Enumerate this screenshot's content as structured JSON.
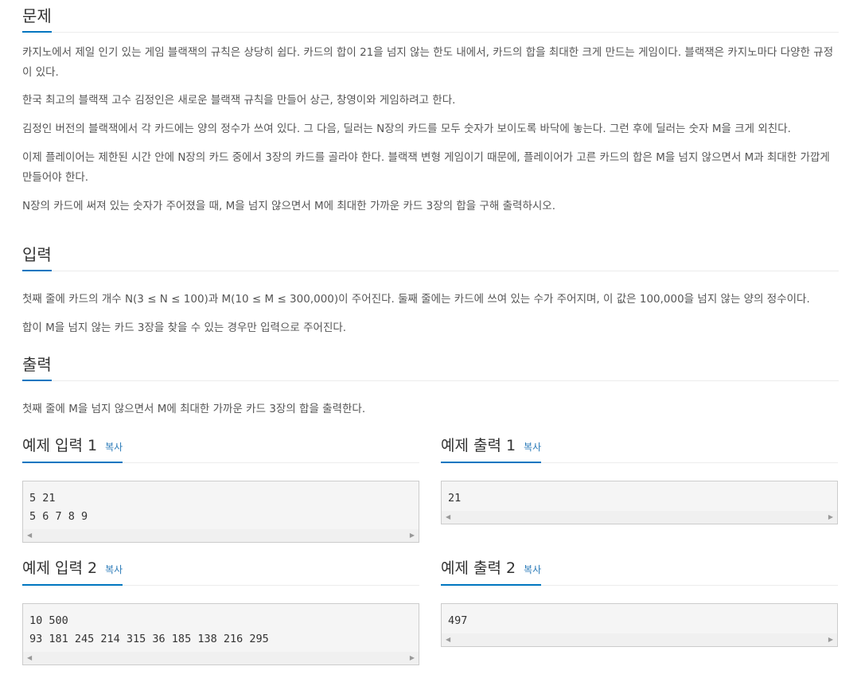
{
  "sections": {
    "problem": {
      "title": "문제",
      "paragraphs": [
        "카지노에서 제일 인기 있는 게임 블랙잭의 규칙은 상당히 쉽다. 카드의 합이 21을 넘지 않는 한도 내에서, 카드의 합을 최대한 크게 만드는 게임이다. 블랙잭은 카지노마다 다양한 규정이 있다.",
        "한국 최고의 블랙잭 고수 김정인은 새로운 블랙잭 규칙을 만들어 상근, 창영이와 게임하려고 한다.",
        "김정인 버전의 블랙잭에서 각 카드에는 양의 정수가 쓰여 있다. 그 다음, 딜러는 N장의 카드를 모두 숫자가 보이도록 바닥에 놓는다. 그런 후에 딜러는 숫자 M을 크게 외친다.",
        "이제 플레이어는 제한된 시간 안에 N장의 카드 중에서 3장의 카드를 골라야 한다. 블랙잭 변형 게임이기 때문에, 플레이어가 고른 카드의 합은 M을 넘지 않으면서 M과 최대한 가깝게 만들어야 한다.",
        "N장의 카드에 써져 있는 숫자가 주어졌을 때, M을 넘지 않으면서 M에 최대한 가까운 카드 3장의 합을 구해 출력하시오."
      ]
    },
    "input": {
      "title": "입력",
      "paragraphs": [
        "첫째 줄에 카드의 개수 N(3 ≤ N ≤ 100)과 M(10 ≤ M ≤ 300,000)이 주어진다. 둘째 줄에는 카드에 쓰여 있는 수가 주어지며, 이 값은 100,000을 넘지 않는 양의 정수이다.",
        "합이 M을 넘지 않는 카드 3장을 찾을 수 있는 경우만 입력으로 주어진다."
      ]
    },
    "output": {
      "title": "출력",
      "paragraphs": [
        "첫째 줄에 M을 넘지 않으면서 M에 최대한 가까운 카드 3장의 합을 출력한다."
      ]
    }
  },
  "copy_label": "복사",
  "samples": [
    {
      "input_title": "예제 입력 1",
      "input_text": "5 21\n5 6 7 8 9",
      "output_title": "예제 출력 1",
      "output_text": "21"
    },
    {
      "input_title": "예제 입력 2",
      "input_text": "10 500\n93 181 245 214 315 36 185 138 216 295",
      "output_title": "예제 출력 2",
      "output_text": "497"
    }
  ],
  "colors": {
    "accent": "#0076c0",
    "link": "#2a7ab8",
    "text": "#555555",
    "heading": "#333333",
    "sample_bg": "#f5f5f5"
  }
}
